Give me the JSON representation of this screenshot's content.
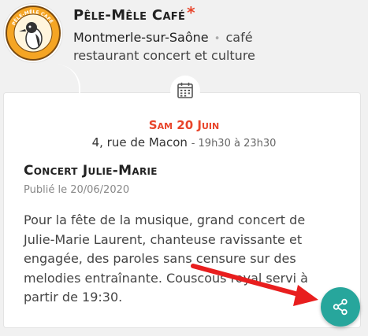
{
  "header": {
    "name": "Pêle-Mêle Café",
    "star": "*",
    "city": "Montmerle-sur-Saône",
    "separator": "•",
    "category": "café",
    "description": "restaurant concert et culture",
    "logo_text": "PÊLE-MÊLE CAFÉ"
  },
  "event": {
    "date": "Sam 20 Juin",
    "address": "4, rue de Macon",
    "time": "- 19h30 à 23h30",
    "title": "Concert Julie-Marie",
    "published": "Publié le 20/06/2020",
    "body": "Pour la fête de la musique, grand concert de Julie-Marie Laurent, chanteuse ravissante et engagée, des paroles sans censure sur des melodies entraînante. Couscous royal servi à partir de 19:30."
  },
  "icons": {
    "calendar": "calendar-icon",
    "share": "share-icon"
  },
  "colors": {
    "accent_red": "#e8452b",
    "share_teal": "#27a69c",
    "logo_orange": "#f5a524"
  }
}
